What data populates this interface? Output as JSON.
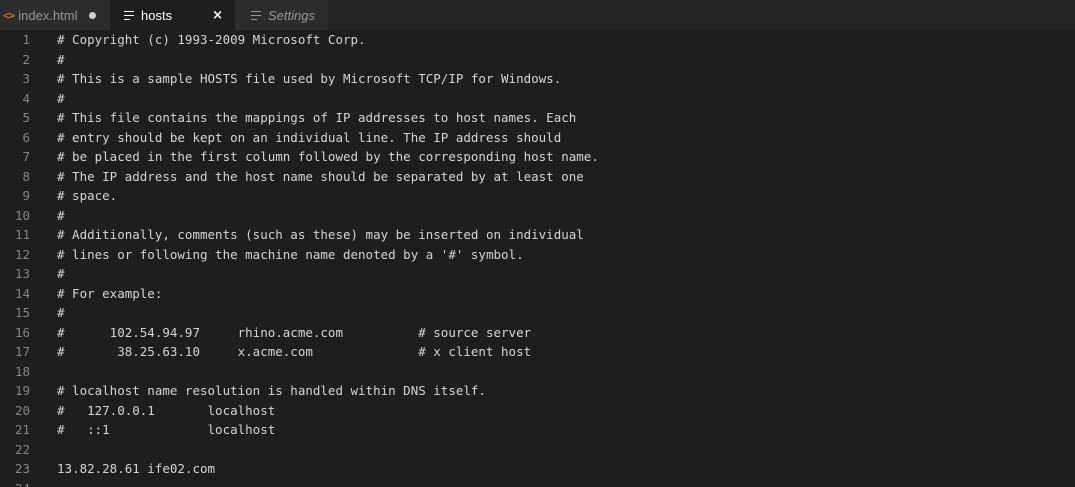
{
  "tabs": [
    {
      "label": "index.html",
      "icon": "html-file-icon",
      "dirty": true
    },
    {
      "label": "hosts",
      "icon": "text-file-icon",
      "active": true,
      "close": "×"
    },
    {
      "label": "Settings",
      "icon": "text-file-icon",
      "italic": true
    }
  ],
  "editor": {
    "lines": [
      {
        "n": "1",
        "text": "# Copyright (c) 1993-2009 Microsoft Corp."
      },
      {
        "n": "2",
        "text": "#"
      },
      {
        "n": "3",
        "text": "# This is a sample HOSTS file used by Microsoft TCP/IP for Windows."
      },
      {
        "n": "4",
        "text": "#"
      },
      {
        "n": "5",
        "text": "# This file contains the mappings of IP addresses to host names. Each"
      },
      {
        "n": "6",
        "text": "# entry should be kept on an individual line. The IP address should"
      },
      {
        "n": "7",
        "text": "# be placed in the first column followed by the corresponding host name."
      },
      {
        "n": "8",
        "text": "# The IP address and the host name should be separated by at least one"
      },
      {
        "n": "9",
        "text": "# space."
      },
      {
        "n": "10",
        "text": "#"
      },
      {
        "n": "11",
        "text": "# Additionally, comments (such as these) may be inserted on individual"
      },
      {
        "n": "12",
        "text": "# lines or following the machine name denoted by a '#' symbol."
      },
      {
        "n": "13",
        "text": "#"
      },
      {
        "n": "14",
        "text": "# For example:"
      },
      {
        "n": "15",
        "text": "#"
      },
      {
        "n": "16",
        "text": "#      102.54.94.97     rhino.acme.com          # source server"
      },
      {
        "n": "17",
        "text": "#       38.25.63.10     x.acme.com              # x client host"
      },
      {
        "n": "18",
        "text": ""
      },
      {
        "n": "19",
        "text": "# localhost name resolution is handled within DNS itself."
      },
      {
        "n": "20",
        "text": "#   127.0.0.1       localhost"
      },
      {
        "n": "21",
        "text": "#   ::1             localhost"
      },
      {
        "n": "22",
        "text": ""
      },
      {
        "n": "23",
        "text": "13.82.28.61 ife02.com"
      },
      {
        "n": "24",
        "text": ""
      }
    ]
  }
}
